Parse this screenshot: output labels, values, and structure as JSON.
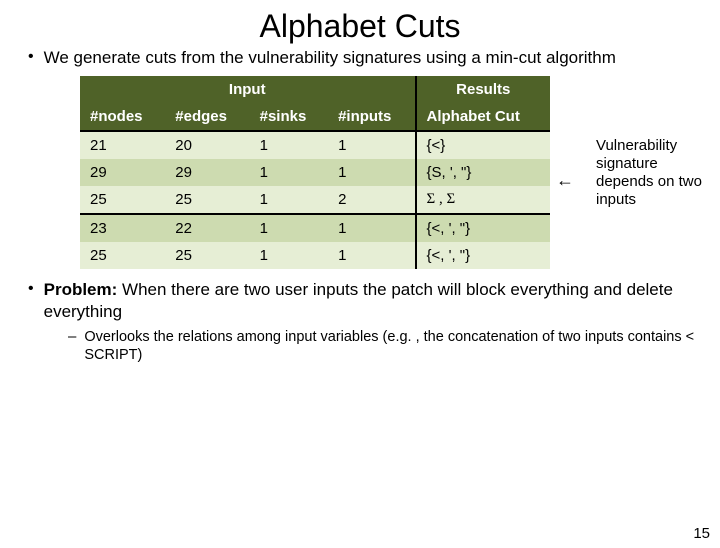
{
  "title": "Alphabet Cuts",
  "bullet1": "We generate cuts from the vulnerability signatures using a min-cut algorithm",
  "table": {
    "group_input": "Input",
    "group_results": "Results",
    "h_nodes": "#nodes",
    "h_edges": "#edges",
    "h_sinks": "#sinks",
    "h_inputs": "#inputs",
    "h_alpha": "Alphabet Cut",
    "rows": [
      {
        "nodes": "21",
        "edges": "20",
        "sinks": "1",
        "inputs": "1",
        "alpha": "{<}"
      },
      {
        "nodes": "29",
        "edges": "29",
        "sinks": "1",
        "inputs": "1",
        "alpha": "{S, ', \"}"
      },
      {
        "nodes": "25",
        "edges": "25",
        "sinks": "1",
        "inputs": "2",
        "alpha": "Σ , Σ"
      },
      {
        "nodes": "23",
        "edges": "22",
        "sinks": "1",
        "inputs": "1",
        "alpha": "{<, ', \"}"
      },
      {
        "nodes": "25",
        "edges": "25",
        "sinks": "1",
        "inputs": "1",
        "alpha": "{<, ', \"}"
      }
    ]
  },
  "side_note": "Vulnerability signature depends on two inputs",
  "problem_label": "Problem:",
  "problem_rest": " When there are two user inputs the patch will block everything and delete everything",
  "sub": "Overlooks the relations among input variables (e.g. , the concatenation of two inputs contains < SCRIPT)",
  "pagenum": "15",
  "arrow_glyph": "←"
}
